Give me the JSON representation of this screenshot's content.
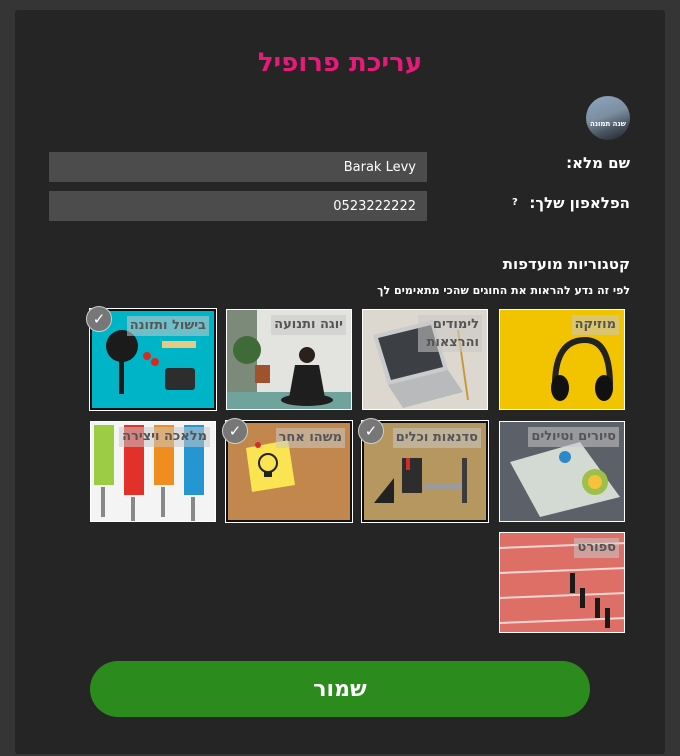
{
  "page_title": "עריכת פרופיל",
  "avatar_text": "שנה תמונה",
  "form": {
    "name_label": "שם מלא:",
    "name_value": "Barak Levy",
    "phone_label": "הפלאפון שלך:",
    "phone_help": "?",
    "phone_value": "0523222222"
  },
  "categories": {
    "title": "קטגוריות מועדפות",
    "subtitle": "לפי זה נדע להראות את החוגים שהכי מתאימים לך",
    "items": [
      {
        "label": "מוזיקה",
        "selected": false
      },
      {
        "label": "לימודים והרצאות",
        "selected": false
      },
      {
        "label": "יוגה ותנועה",
        "selected": false
      },
      {
        "label": "בישול ותזונה",
        "selected": true
      },
      {
        "label": "סיורים וטיולים",
        "selected": false
      },
      {
        "label": "סדנאות וכלים",
        "selected": true
      },
      {
        "label": "משהו אחר",
        "selected": true
      },
      {
        "label": "מלאכה ויצירה",
        "selected": false
      },
      {
        "label": "ספורט",
        "selected": false
      }
    ]
  },
  "save_label": "שמור",
  "check_glyph": "✓"
}
